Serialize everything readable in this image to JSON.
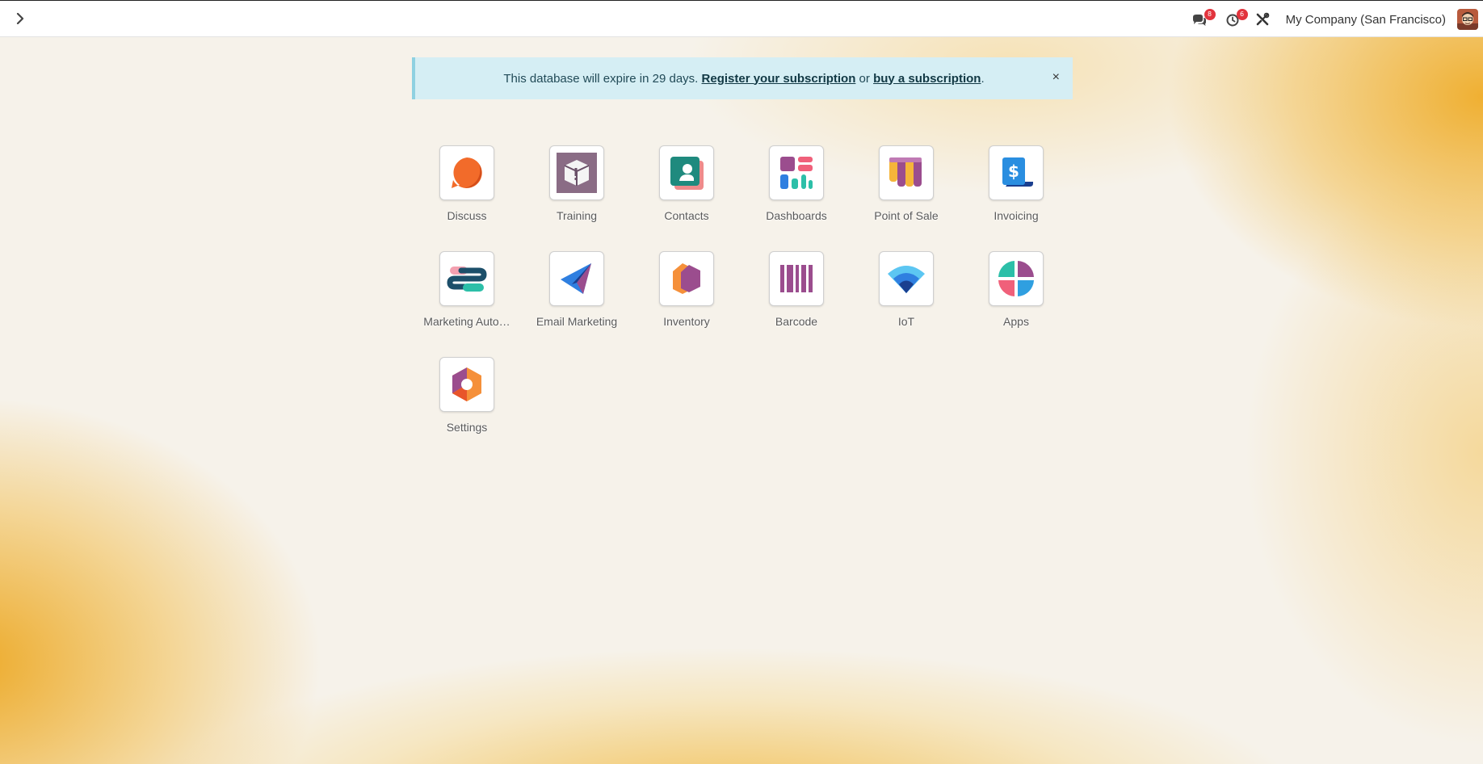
{
  "navbar": {
    "toggle_icon": "chevron-right-icon",
    "messages_badge": "8",
    "activities_badge": "6",
    "company": "My Company (San Francisco)"
  },
  "banner": {
    "text_before": "This database will expire in 29 days. ",
    "register_link": "Register your subscription",
    "text_middle": " or ",
    "buy_link": "buy a subscription",
    "text_after": ".",
    "close": "×"
  },
  "apps": [
    {
      "label": "Discuss"
    },
    {
      "label": "Training"
    },
    {
      "label": "Contacts"
    },
    {
      "label": "Dashboards"
    },
    {
      "label": "Point of Sale"
    },
    {
      "label": "Invoicing"
    },
    {
      "label": "Marketing Auto…"
    },
    {
      "label": "Email Marketing"
    },
    {
      "label": "Inventory"
    },
    {
      "label": "Barcode"
    },
    {
      "label": "IoT"
    },
    {
      "label": "Apps"
    },
    {
      "label": "Settings"
    }
  ]
}
